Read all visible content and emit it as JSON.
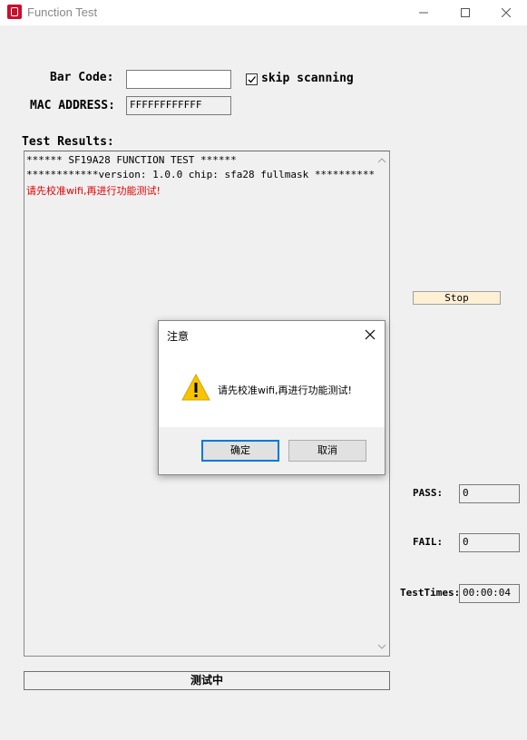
{
  "window": {
    "title": "Function Test"
  },
  "form": {
    "barcode_label": "Bar Code:",
    "barcode_value": "",
    "skip_label": "skip scanning",
    "skip_checked": true,
    "mac_label": "MAC ADDRESS:",
    "mac_value": "FFFFFFFFFFFF",
    "results_label": "Test Results:"
  },
  "results": {
    "lines": [
      "****** SF19A28 FUNCTION TEST ******",
      "************version: 1.0.0 chip: sfa28 fullmask ************",
      "请先校准wifi,再进行功能测试!"
    ]
  },
  "controls": {
    "stop_label": "Stop",
    "status_label": "测试中"
  },
  "stats": {
    "pass_label": "PASS:",
    "pass_value": "0",
    "fail_label": "FAIL:",
    "fail_value": "0",
    "time_label": "TestTimes:",
    "time_value": "00:00:04"
  },
  "dialog": {
    "title": "注意",
    "message": "请先校准wifi,再进行功能测试!",
    "ok_label": "确定",
    "cancel_label": "取消"
  },
  "colors": {
    "error_text": "#e00000",
    "accent": "#0078d7",
    "warning": "#f7c500"
  }
}
